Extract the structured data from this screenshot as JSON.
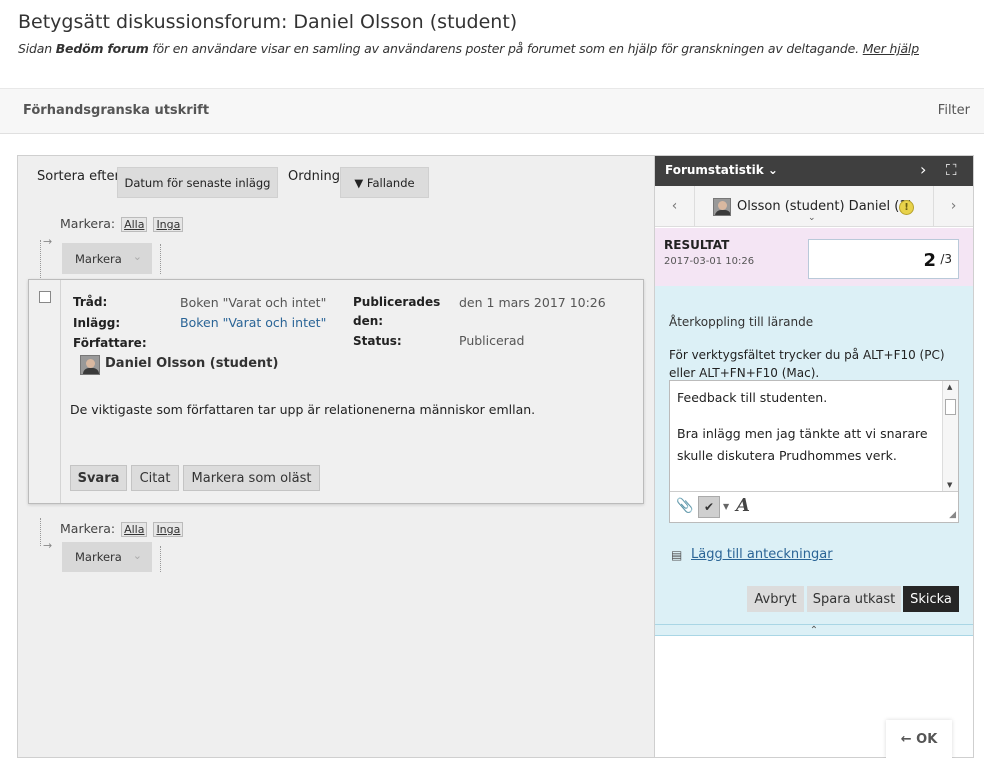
{
  "header": {
    "title": "Betygsätt diskussionsforum: Daniel Olsson (student)",
    "desc_prefix": "Sidan",
    "desc_bold": "Bedöm forum",
    "desc_rest": "för en användare visar en samling av användarens poster på forumet som en hjälp för granskningen av deltagande.",
    "more_help": "Mer hjälp"
  },
  "action_bar": {
    "print_preview": "Förhandsgranska utskrift",
    "filter": "Filter"
  },
  "sort": {
    "sort_label": "Sortera efter",
    "sort_value": "Datum för senaste inlägg",
    "order_label": "Ordning",
    "order_value": "▼ Fallande"
  },
  "select": {
    "label": "Markera:",
    "all": "Alla",
    "none": "Inga",
    "mark_button": "Markera"
  },
  "post": {
    "thread_label": "Tråd:",
    "thread_value": "Boken \"Varat och intet\"",
    "post_label": "Inlägg:",
    "post_value": "Boken \"Varat och intet\"",
    "author_label": "Författare:",
    "author_name": "Daniel Olsson (student)",
    "published_label_1": "Publicerades",
    "published_label_2": "den:",
    "published_value": "den 1 mars 2017 10:26",
    "status_label": "Status:",
    "status_value": "Publicerad",
    "body": "De viktigaste som författaren tar upp är relationenerna människor emllan.",
    "reply_button": "Svara",
    "quote_button": "Citat",
    "mark_unread_button": "Markera som oläst"
  },
  "sidebar": {
    "stats_title": "Forumstatistik",
    "student_name": "Olsson (student) Daniel (1)",
    "result_label": "RESULTAT",
    "result_date": "2017-03-01 10:26",
    "score": "2",
    "score_max": "/3",
    "feedback_title": "Återkoppling till lärande",
    "toolbar_hint": "För verktygsfältet trycker du på ALT+F10 (PC) eller ALT+FN+F10 (Mac).",
    "feedback_line1": "Feedback till studenten.",
    "feedback_line2": "Bra inlägg men jag tänkte att vi snarare skulle diskutera Prudhommes verk.",
    "add_notes": "Lägg till anteckningar",
    "cancel_button": "Avbryt",
    "save_draft_button": "Spara utkast",
    "send_button": "Skicka"
  },
  "ok_button": "← OK"
}
